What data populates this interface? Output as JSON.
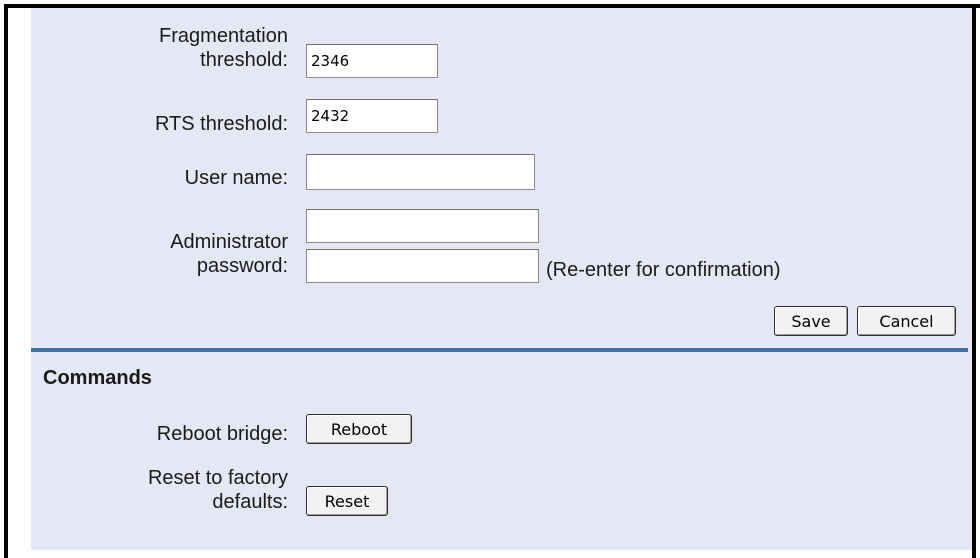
{
  "settings": {
    "fragmentation": {
      "label_line1": "Fragmentation",
      "label_line2": "threshold:",
      "value": "2346"
    },
    "rts": {
      "label": "RTS threshold:",
      "value": "2432"
    },
    "username": {
      "label": "User name:",
      "value": ""
    },
    "admin_password": {
      "label_line1": "Administrator",
      "label_line2": "password:",
      "value": "",
      "confirm_value": "",
      "confirm_hint": "(Re-enter for confirmation)"
    },
    "save_label": "Save",
    "cancel_label": "Cancel"
  },
  "commands": {
    "title": "Commands",
    "reboot": {
      "label": "Reboot bridge:",
      "button": "Reboot"
    },
    "reset": {
      "label_line1": "Reset to factory",
      "label_line2": "defaults:",
      "button": "Reset"
    }
  }
}
